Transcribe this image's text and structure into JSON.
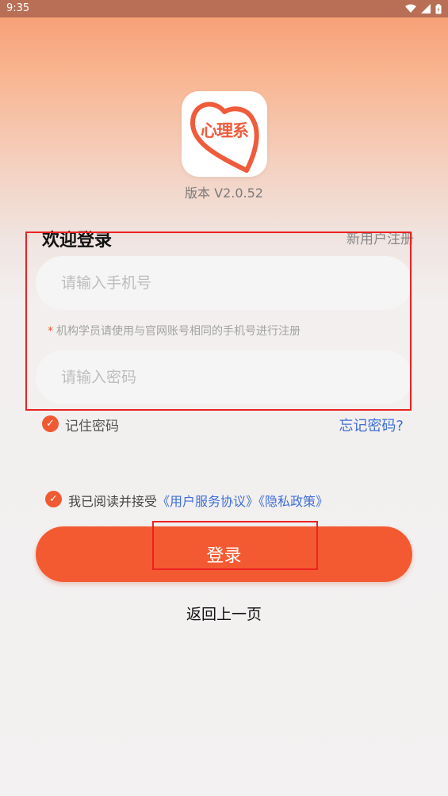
{
  "status_bar": {
    "time": "9:35"
  },
  "app": {
    "logo_text": "心理系",
    "version": "版本 V2.0.52"
  },
  "login": {
    "welcome": "欢迎登录",
    "register_link": "新用户注册",
    "phone_placeholder": "请输入手机号",
    "hint": "机构学员请使用与官网账号相同的手机号进行注册",
    "hint_star": "*",
    "password_placeholder": "请输入密码",
    "remember_label": "记住密码",
    "remember_checked": true,
    "forgot_link": "忘记密码?",
    "agree_prefix": "我已阅读并接受",
    "service_link": "《用户服务协议》",
    "privacy_link": "《隐私政策》",
    "agree_checked": true,
    "login_button": "登录",
    "back_link": "返回上一页"
  },
  "colors": {
    "accent": "#f45a32",
    "link": "#3f6fd6",
    "highlight": "#ec2222"
  }
}
